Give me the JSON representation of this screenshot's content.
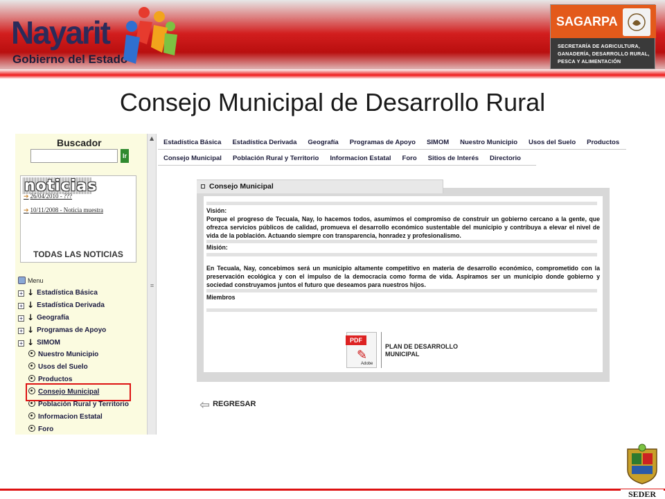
{
  "header": {
    "brand_main": "Nayarit",
    "brand_sub": "Gobierno del Estado",
    "sagarpa_name": "SAGARPA",
    "sagarpa_desc": "SECRETARÍA DE AGRICULTURA, GANADERÍA, DESARROLLO RURAL, PESCA Y ALIMENTACIÓN"
  },
  "page_title": "Consejo Municipal de Desarrollo Rural",
  "sidebar": {
    "search_title": "Buscador",
    "search_value": "",
    "search_button": "Ir",
    "news_title": "noticias",
    "news_items": [
      "26/04/2010 - ???",
      "10/11/2008 - Noticia muestra"
    ],
    "news_all": "TODAS LAS NOTICIAS",
    "menu_label": "Menu",
    "menu_items": [
      {
        "label": "Estadística Básica",
        "kind": "expand"
      },
      {
        "label": "Estadística Derivada",
        "kind": "expand"
      },
      {
        "label": "Geografía",
        "kind": "expand"
      },
      {
        "label": "Programas de Apoyo",
        "kind": "expand"
      },
      {
        "label": "SIMOM",
        "kind": "expand"
      },
      {
        "label": "Nuestro Municipio",
        "kind": "radio"
      },
      {
        "label": "Usos del Suelo",
        "kind": "radio"
      },
      {
        "label": "Productos",
        "kind": "radio"
      },
      {
        "label": "Consejo Municipal",
        "kind": "radio",
        "active": true
      },
      {
        "label": "Población Rural y Territorio",
        "kind": "radio"
      },
      {
        "label": "Informacion Estatal",
        "kind": "radio"
      },
      {
        "label": "Foro",
        "kind": "radio"
      }
    ]
  },
  "topnav": {
    "row1": [
      "Estadística Básica",
      "Estadística Derivada",
      "Geografía",
      "Programas de Apoyo",
      "SIMOM",
      "Nuestro Municipio",
      "Usos del Suelo",
      "Productos"
    ],
    "row2": [
      "Consejo Municipal",
      "Población Rural y Territorio",
      "Informacion Estatal",
      "Foro",
      "Sitios de Interés",
      "Directorio"
    ]
  },
  "panel": {
    "tab_title": "Consejo Municipal",
    "vision_heading": "Visión:",
    "vision_text": "Porque el progreso de Tecuala, Nay, lo hacemos todos, asumimos el compromiso de construir un gobierno cercano a la gente, que ofrezca servicios públicos de calidad, promueva el desarrollo económico sustentable del municipio y contribuya a elevar el nivel de vida de la población. Actuando siempre con transparencia, honradez y profesionalismo.",
    "mision_heading": "Misión:",
    "mision_text": "En Tecuala, Nay, concebimos será un municipio altamente competitivo en materia de desarrollo económico, comprometido con la preservación ecológica y con el impulso de la democracia como forma de vida. Aspiramos ser un municipio donde gobierno y sociedad construyamos juntos el futuro que deseamos para nuestros hijos.",
    "miembros_heading": "Miembros",
    "pdf_tag": "PDF",
    "pdf_brand": "Adobe",
    "pdf_label": "PLAN DE DESARROLLO MUNICIPAL",
    "back_label": "REGRESAR"
  },
  "footer": {
    "seder_label": "SEDER"
  }
}
